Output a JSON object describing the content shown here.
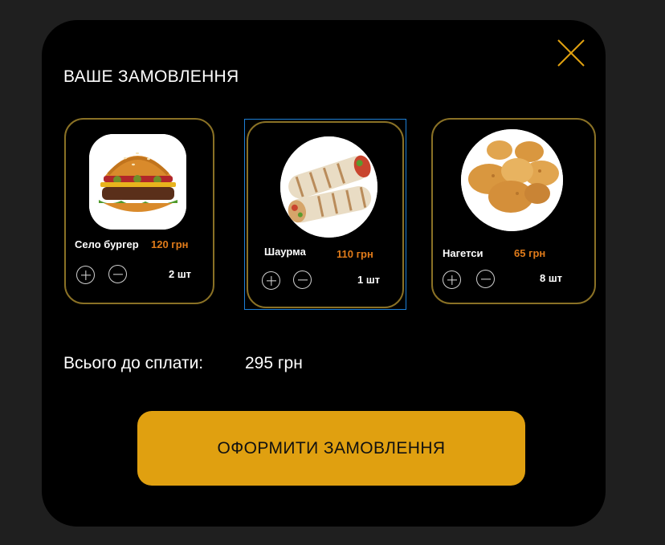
{
  "modal": {
    "title": "ВАШЕ ЗАМОВЛЕННЯ",
    "close_icon": "close-icon",
    "accent_color": "#e0a010",
    "card_border_color": "#8a7125",
    "price_color": "#e07b1a"
  },
  "items": [
    {
      "name": "Село бургер",
      "price": "120 грн",
      "quantity": "2 шт",
      "image": "burger-photo"
    },
    {
      "name": "Шаурма",
      "price": "110 грн",
      "quantity": "1 шт",
      "image": "shawarma-photo"
    },
    {
      "name": "Нагетси",
      "price": "65 грн",
      "quantity": "8 шт",
      "image": "nuggets-photo"
    }
  ],
  "total": {
    "label": "Всього до сплати:",
    "value": "295 грн"
  },
  "checkout": {
    "label": "ОФОРМИТИ ЗАМОВЛЕННЯ"
  }
}
